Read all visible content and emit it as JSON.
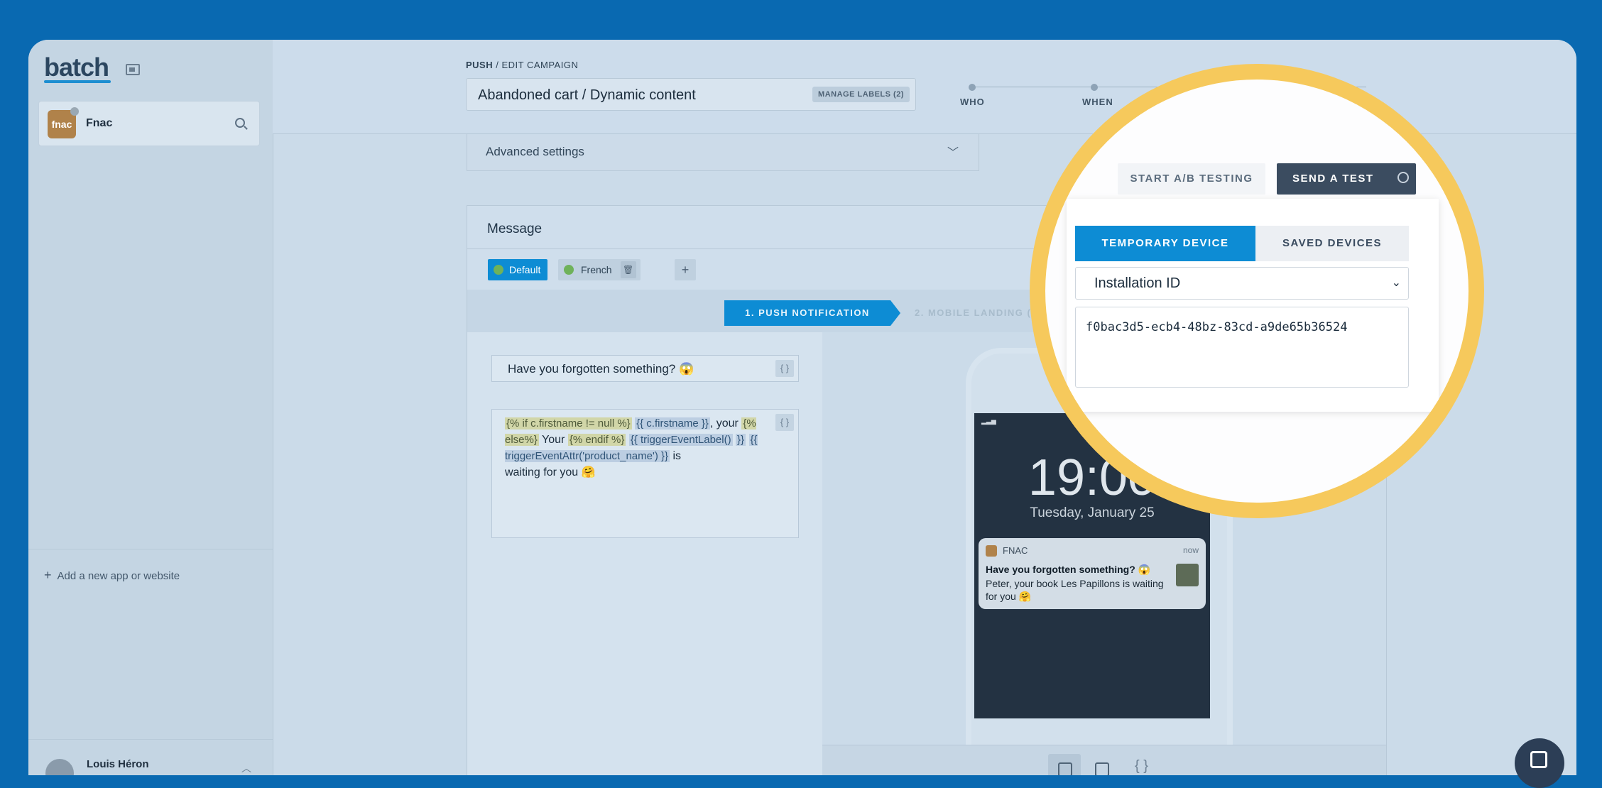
{
  "brand": {
    "logo_text": "batch",
    "accent": "#1d8ed1"
  },
  "sidebar": {
    "app": {
      "logo_text": "fnac",
      "name": "Fnac"
    },
    "add_app_label": "Add a new app or website",
    "user": {
      "name": "Louis Héron"
    }
  },
  "header": {
    "breadcrumb_section": "PUSH",
    "breadcrumb_page": " / EDIT CAMPAIGN",
    "campaign_name": "Abandoned cart / Dynamic content",
    "manage_labels": "MANAGE LABELS (2)",
    "steps": [
      "WHO",
      "WHEN"
    ]
  },
  "advanced": {
    "label": "Advanced settings"
  },
  "message": {
    "title": "Message",
    "languages": {
      "default": "Default",
      "french": "French",
      "add": "+"
    },
    "tabs": {
      "push": "1. PUSH NOTIFICATION",
      "landing": "2. MOBILE LANDING ("
    },
    "title_field": "Have you forgotten something? 😱",
    "brace": "{ }",
    "body": {
      "t1": "{% if c.firstname != null %}",
      "t2": "{{ c.firstname }}",
      "t3": ", your",
      "t4": "{% else%}",
      "t5": " Your ",
      "t6": "{% endif %}",
      "t7": "{{ triggerEventLabel()",
      "t8": "}}",
      "t9": "{{ triggerEventAttr('product_name') }}",
      "t10": " is",
      "t11": "waiting for you 🤗"
    }
  },
  "preview": {
    "time": "19:00",
    "date": "Tuesday, January 25",
    "notif_app": "FNAC",
    "notif_time": "now",
    "notif_title": "Have you forgotten something? 😱",
    "notif_body": "Peter, your book Les Papillons is waiting for you 🤗",
    "foot_brace": "{ }"
  },
  "test_panel": {
    "ab_button": "START A/B TESTING",
    "send_button": "SEND A TEST",
    "tab_temporary": "TEMPORARY DEVICE",
    "tab_saved": "SAVED DEVICES",
    "id_type": "Installation ID",
    "id_value": "f0bac3d5-ecb4-48bz-83cd-a9de65b36524",
    "highlight_color": "#f6c95c"
  }
}
